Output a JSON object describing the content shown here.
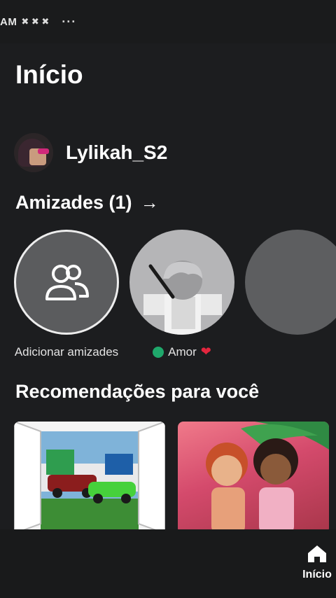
{
  "status_bar": {
    "time": "AM",
    "notifications": "✖ ✖ ✖",
    "more": "···"
  },
  "page": {
    "title": "Início"
  },
  "profile": {
    "username": "Lylikah_S2"
  },
  "friends": {
    "header": "Amizades (1)",
    "items": [
      {
        "label": "Adicionar amizades"
      },
      {
        "label": "Amor",
        "status": "online"
      }
    ]
  },
  "recommendations": {
    "title": "Recomendações para você"
  },
  "bottom_nav": {
    "home_label": "Início"
  },
  "colors": {
    "background": "#1c1d1f",
    "online_dot": "#1fa86b",
    "heart": "#e3263e"
  }
}
